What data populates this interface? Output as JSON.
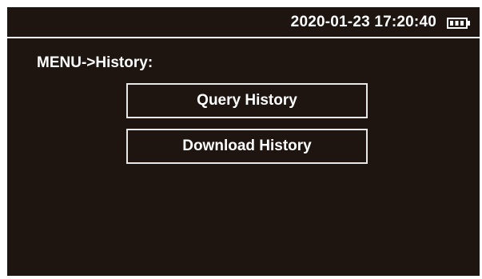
{
  "status_bar": {
    "datetime": "2020-01-23 17:20:40",
    "battery_icon": "battery-icon",
    "battery_level": "3/3 bars"
  },
  "breadcrumb": "MENU->History:",
  "menu": {
    "items": [
      {
        "label": "Query History"
      },
      {
        "label": "Download History"
      }
    ]
  },
  "colors": {
    "background": "#1e1510",
    "text": "#ffffff",
    "border": "#e8e8e8",
    "frame": "#ffffff"
  }
}
